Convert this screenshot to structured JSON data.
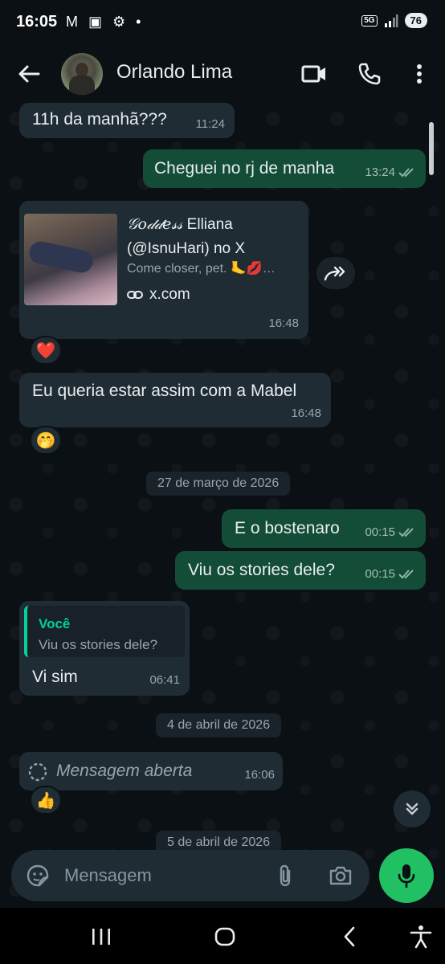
{
  "status_bar": {
    "time": "16:05",
    "left_icons": "M ▣ ⚙ •",
    "network": "5G",
    "battery": "76"
  },
  "header": {
    "contact_name": "Orlando Lima"
  },
  "messages": {
    "m1": {
      "text": "11h da manhã???",
      "time": "11:24"
    },
    "m2": {
      "text": "Cheguei no rj de manha",
      "time": "13:24"
    },
    "m3": {
      "title_fancy": "𝒢𝑜𝒹𝒹𝑒𝓈𝓈",
      "title_rest": " Elliana (@IsnuHari) no X",
      "description": "Come closer, pet. 🦶💋…",
      "domain": "x.com",
      "time": "16:48",
      "reaction": "❤️"
    },
    "m4": {
      "text": "Eu queria estar assim com a Mabel",
      "time": "16:48",
      "reaction": "🤭"
    },
    "date1": "27 de março de 2026",
    "m5": {
      "text": "E o bostenaro",
      "time": "00:15"
    },
    "m6": {
      "text": "Viu os stories dele?",
      "time": "00:15"
    },
    "m7": {
      "quote_author": "Você",
      "quote_text": "Viu os stories dele?",
      "text": "Vi sim",
      "time": "06:41"
    },
    "date2": "4 de abril de 2026",
    "m8": {
      "text": "Mensagem aberta",
      "time": "16:06",
      "reaction": "👍"
    },
    "date3": "5 de abril de 2026"
  },
  "input": {
    "placeholder": "Mensagem"
  },
  "colors": {
    "background": "#0b1014",
    "incoming_bubble": "#1f2c33",
    "outgoing_bubble": "#144d37",
    "accent": "#21c063",
    "read_ticks": "#8fb3a4"
  },
  "icons": [
    "back-arrow-icon",
    "video-call-icon",
    "phone-icon",
    "more-options-icon",
    "forward-icon",
    "link-icon",
    "view-once-icon",
    "double-chevron-down-icon",
    "sticker-icon",
    "paperclip-icon",
    "camera-icon",
    "mic-icon",
    "recent-apps-icon",
    "home-icon",
    "back-nav-icon",
    "accessibility-icon"
  ]
}
